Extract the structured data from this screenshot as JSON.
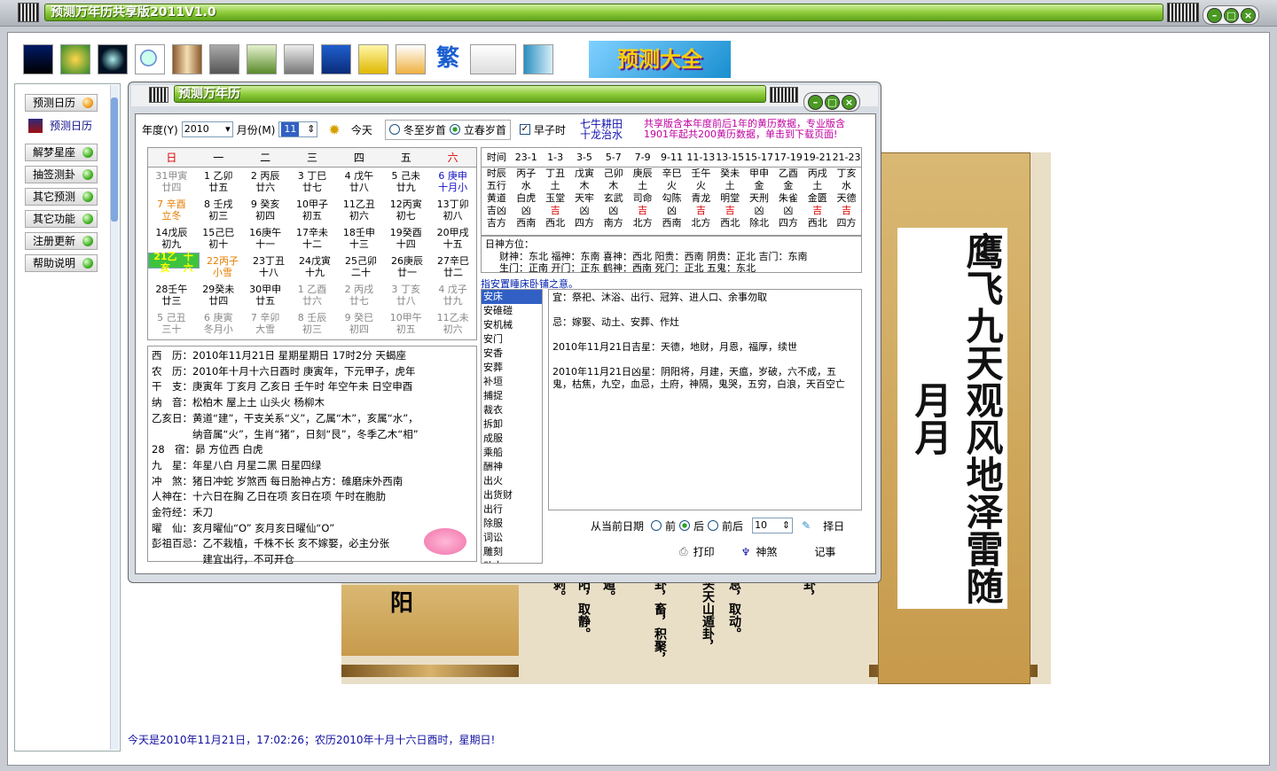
{
  "app": {
    "title": "预测万年历共享版2011V1.0",
    "inner_title": "预测万年历",
    "banner": "预测大全"
  },
  "sidebar": {
    "items": [
      {
        "label": "预测日历"
      },
      {
        "label": "预测日历"
      },
      {
        "label": "解梦星座"
      },
      {
        "label": "抽签测卦"
      },
      {
        "label": "其它预测"
      },
      {
        "label": "其它功能"
      },
      {
        "label": "注册更新"
      },
      {
        "label": "帮助说明"
      }
    ]
  },
  "controls": {
    "year_label": "年度(Y)",
    "year_value": "2010",
    "month_label": "月份(M)",
    "month_value": "11",
    "today_label": "今天",
    "winter_label": "冬至岁首",
    "spring_label": "立春岁首",
    "early_label": "早子时",
    "stars": "七牛耕田\n十龙治水",
    "notice": "共享版含本年度前后1年的黄历数据，专业版含1901年起共200黄历数据，单击到下载页面!"
  },
  "weekdays": [
    "日",
    "一",
    "二",
    "三",
    "四",
    "五",
    "六"
  ],
  "calendar": [
    [
      {
        "d": "31甲寅",
        "l": "廿四",
        "c": "dim"
      },
      {
        "d": "1 乙卯",
        "l": "廿五"
      },
      {
        "d": "2 丙辰",
        "l": "廿六"
      },
      {
        "d": "3 丁巳",
        "l": "廿七"
      },
      {
        "d": "4 戊午",
        "l": "廿八"
      },
      {
        "d": "5 己未",
        "l": "廿九"
      },
      {
        "d": "6 庚申",
        "l": "十月小",
        "c": "blue"
      }
    ],
    [
      {
        "d": "7 辛酉",
        "l": "立冬",
        "c": "hol"
      },
      {
        "d": "8 壬戌",
        "l": "初三"
      },
      {
        "d": "9 癸亥",
        "l": "初四"
      },
      {
        "d": "10甲子",
        "l": "初五"
      },
      {
        "d": "11乙丑",
        "l": "初六"
      },
      {
        "d": "12丙寅",
        "l": "初七"
      },
      {
        "d": "13丁卯",
        "l": "初八"
      }
    ],
    [
      {
        "d": "14戊辰",
        "l": "初九"
      },
      {
        "d": "15己巳",
        "l": "初十"
      },
      {
        "d": "16庚午",
        "l": "十一"
      },
      {
        "d": "17辛未",
        "l": "十二"
      },
      {
        "d": "18壬申",
        "l": "十三"
      },
      {
        "d": "19癸酉",
        "l": "十四"
      },
      {
        "d": "20甲戌",
        "l": "十五"
      }
    ],
    [
      {
        "d": "21乙亥",
        "l": "十六",
        "c": "sel"
      },
      {
        "d": "22丙子",
        "l": "小雪",
        "c": "hol"
      },
      {
        "d": "23丁丑",
        "l": "十八"
      },
      {
        "d": "24戊寅",
        "l": "十九"
      },
      {
        "d": "25己卯",
        "l": "二十"
      },
      {
        "d": "26庚辰",
        "l": "廿一"
      },
      {
        "d": "27辛巳",
        "l": "廿二"
      }
    ],
    [
      {
        "d": "28壬午",
        "l": "廿三"
      },
      {
        "d": "29癸未",
        "l": "廿四"
      },
      {
        "d": "30甲申",
        "l": "廿五"
      },
      {
        "d": "1 乙酉",
        "l": "廿六",
        "c": "dim"
      },
      {
        "d": "2 丙戌",
        "l": "廿七",
        "c": "dim"
      },
      {
        "d": "3 丁亥",
        "l": "廿八",
        "c": "dim"
      },
      {
        "d": "4 戊子",
        "l": "廿九",
        "c": "dim"
      }
    ],
    [
      {
        "d": "5 己丑",
        "l": "三十",
        "c": "dim"
      },
      {
        "d": "6 庚寅",
        "l": "冬月小",
        "c": "dim"
      },
      {
        "d": "7 辛卯",
        "l": "大雪",
        "c": "dim"
      },
      {
        "d": "8 壬辰",
        "l": "初三",
        "c": "dim"
      },
      {
        "d": "9 癸巳",
        "l": "初四",
        "c": "dim"
      },
      {
        "d": "10甲午",
        "l": "初五",
        "c": "dim"
      },
      {
        "d": "11乙未",
        "l": "初六",
        "c": "dim"
      }
    ]
  ],
  "info": [
    "西　历：2010年11月21日  星期星期日      17时2分    天蝎座",
    "农　历：2010年十月十六日酉时    庚寅年，下元甲子，虎年",
    "干　支：庚寅年    丁亥月    乙亥日    壬午时        年空午未  日空申酉",
    "纳　音：松柏木    屋上土    山头火    杨柳木",
    "乙亥日：黄道“建”，干支关系“义”，乙属“木”，亥属“水”，",
    "　　　　纳音属“火”，生肖“猪”，日刻“艮”，冬季乙木“相”",
    "28　宿：昴    方位西    白虎",
    "九　星：年星八白  月星二黑  日星四绿",
    "冲　煞：猪日冲蛇    岁煞西        每日胎神占方：碓磨床外西南",
    "人神在：十六日在胸    乙日在项    亥日在项    午时在胞肋",
    "金符经：禾刀",
    "曜　仙：亥月曜仙“O”    亥月亥日曜仙“O”",
    "彭祖百忌：乙不栽植，千株不长    亥不嫁娶，必主分张",
    "　　　　　建宜出行，不可开仓"
  ],
  "hours": {
    "header": [
      "时间",
      "23-1",
      "1-3",
      "3-5",
      "5-7",
      "7-9",
      "9-11",
      "11-13",
      "13-15",
      "15-17",
      "17-19",
      "19-21",
      "21-23"
    ],
    "rows": [
      [
        "时辰",
        "丙子",
        "丁丑",
        "戊寅",
        "己卯",
        "庚辰",
        "辛巳",
        "壬午",
        "癸未",
        "甲申",
        "乙酉",
        "丙戌",
        "丁亥"
      ],
      [
        "五行",
        "水",
        "土",
        "木",
        "木",
        "土",
        "火",
        "火",
        "土",
        "金",
        "金",
        "土",
        "水"
      ],
      [
        "黄道",
        "白虎",
        "玉堂",
        "天牢",
        "玄武",
        "司命",
        "勾陈",
        "青龙",
        "明堂",
        "天刑",
        "朱雀",
        "金匮",
        "天德"
      ],
      [
        "吉凶",
        "凶",
        "吉",
        "凶",
        "凶",
        "吉",
        "凶",
        "吉",
        "吉",
        "凶",
        "凶",
        "吉",
        "吉"
      ],
      [
        "吉方",
        "西南",
        "西北",
        "四方",
        "南方",
        "北方",
        "西南",
        "北方",
        "西北",
        "除北",
        "四方",
        "西北",
        "四方"
      ]
    ]
  },
  "gods": {
    "title": "日神方位：",
    "line1": "财神：东北  福神：东南  喜神：西北  阳贵：西南  阴贵：正北  吉门：东南",
    "line2": "生门：正南  开门：正东            鹤神：西南  死门：正北  五鬼：东北"
  },
  "activity": {
    "caption": "指安置睡床卧铺之意。",
    "items": [
      "安床",
      "安碓磑",
      "安机械",
      "安门",
      "安香",
      "安葬",
      "补垣",
      "捕捉",
      "裁衣",
      "拆卸",
      "成服",
      "乘船",
      "酬神",
      "出火",
      "出货财",
      "出行",
      "除服",
      "词讼",
      "雕刻",
      "动土"
    ]
  },
  "detail": {
    "yi": "宜：祭祀、沐浴、出行、冠笄、进人口、余事勿取",
    "ji": "忌：嫁娶、动土、安葬、作灶",
    "good": "2010年11月21日吉星：天德，地财，月恩，福厚，续世",
    "bad": "2010年11月21日凶星：阴阳将，月建，天瘟，岁破，六不成，五鬼，枯焦，九空，血忌，土府，神隔，鬼哭，五穷，白浪，天百空亡"
  },
  "bottom": {
    "from_label": "从当前日期",
    "before": "前",
    "after": "后",
    "both": "前后",
    "days": "10",
    "choose": "择日",
    "print": "打印",
    "gods": "神煞",
    "note": "记事"
  },
  "background": {
    "calligraphy": "鹰飞九天观风地泽雷随月月",
    "paper_cols": [
      "阳",
      "剥。",
      "阳，取静。",
      "遁。",
      "卦，畜，积聚，",
      "头天山遁卦，",
      "息，取动。",
      "卦，"
    ]
  },
  "footer": "今天是2010年11月21日，17:02:26；农历2010年十月十六日酉时，星期日!"
}
